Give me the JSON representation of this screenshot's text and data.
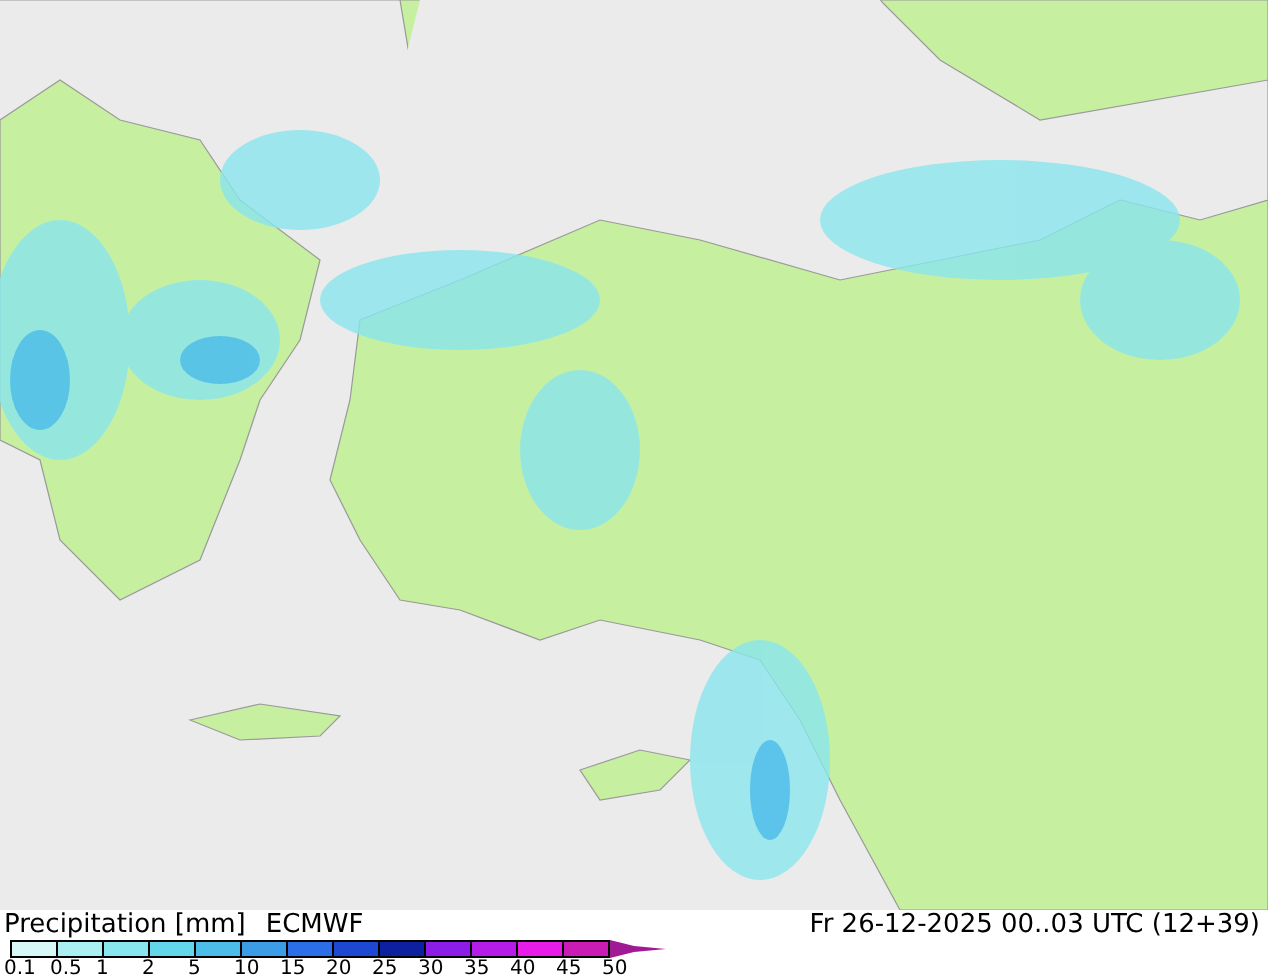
{
  "header": {
    "title": "Precipitation [mm]",
    "model": "ECMWF",
    "valid_time": "Fr 26-12-2025 00..03 UTC (12+39)"
  },
  "legend": {
    "bins": [
      {
        "color": "#d8f8f8"
      },
      {
        "color": "#aaf0f2"
      },
      {
        "color": "#88e6ee"
      },
      {
        "color": "#64d6ea"
      },
      {
        "color": "#4cbce8"
      },
      {
        "color": "#3c9ce6"
      },
      {
        "color": "#2c6ee8"
      },
      {
        "color": "#1c48d2"
      },
      {
        "color": "#0c20a0"
      },
      {
        "color": "#8c1ce8"
      },
      {
        "color": "#b41ce8"
      },
      {
        "color": "#e81ce8"
      },
      {
        "color": "#c81cb4"
      }
    ],
    "overflow": {
      "color": "#a01a96"
    },
    "labels": [
      "0.1",
      "0.5",
      "1",
      "2",
      "5",
      "10",
      "15",
      "20",
      "25",
      "30",
      "35",
      "40",
      "45",
      "50"
    ]
  }
}
